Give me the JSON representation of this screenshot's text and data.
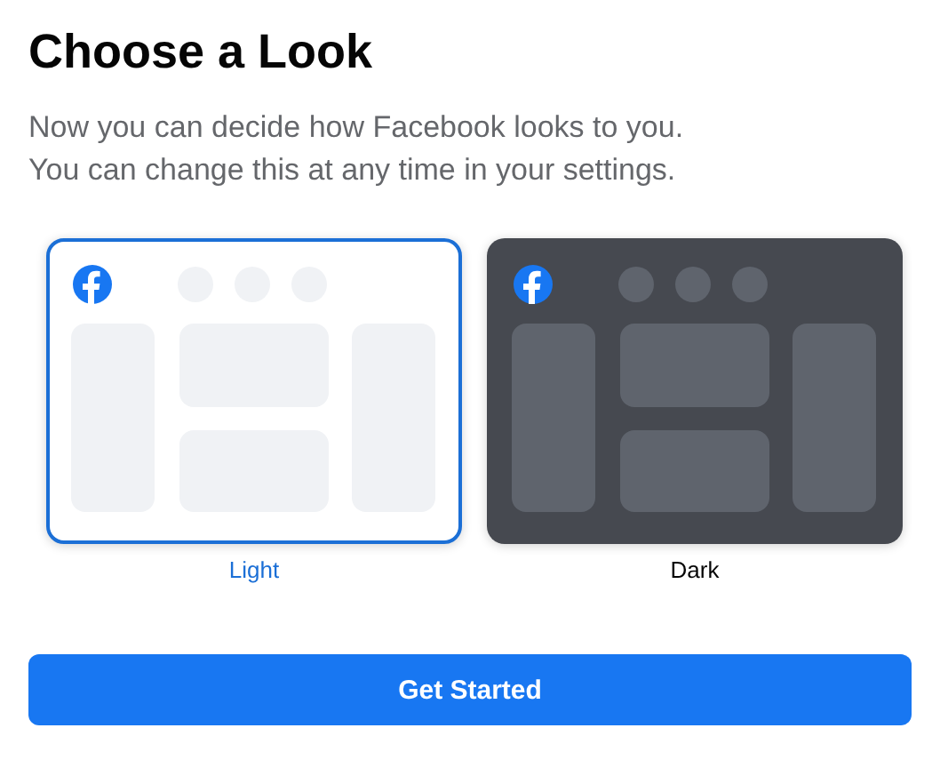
{
  "title": "Choose a Look",
  "subtitle_lines": [
    "Now you can decide how Facebook looks to you.",
    "You can change this at any time in your settings."
  ],
  "options": [
    {
      "kind": "light",
      "label": "Light",
      "selected": true
    },
    {
      "kind": "dark",
      "label": "Dark",
      "selected": false
    }
  ],
  "button": "Get Started"
}
